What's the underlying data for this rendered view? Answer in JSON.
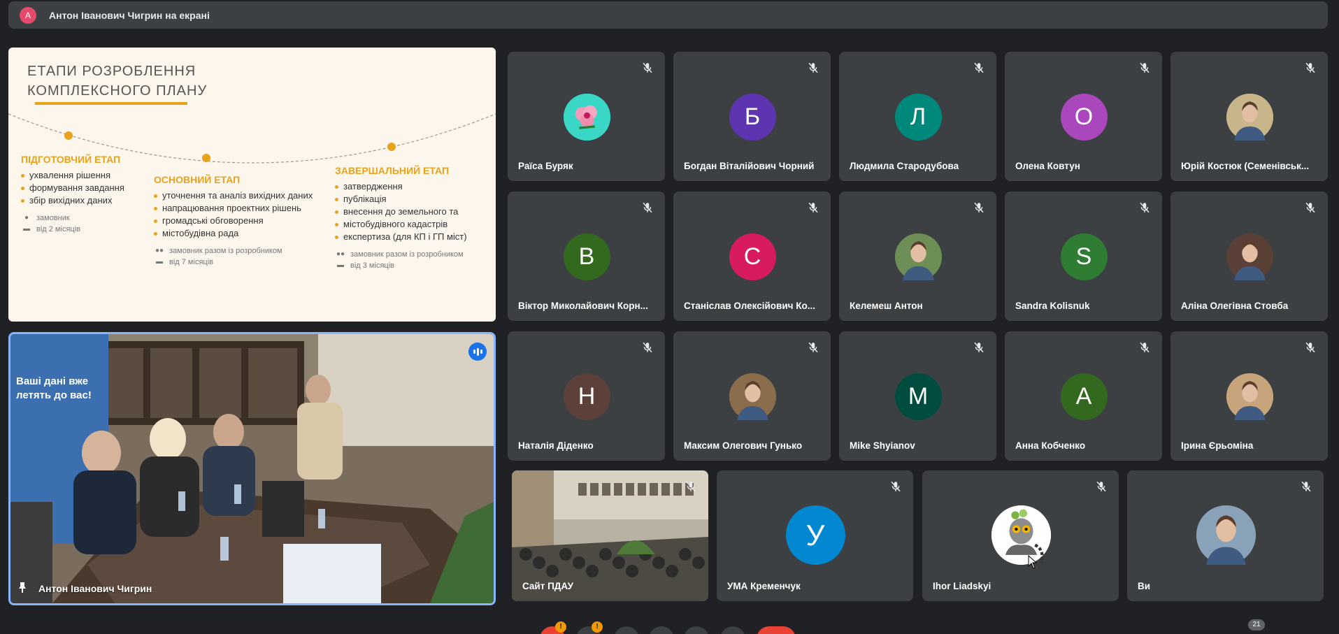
{
  "topbar": {
    "avatar_letter": "А",
    "presenting_text": "Антон Іванович Чигрин на екрані"
  },
  "slide": {
    "title_line1": "ЕТАПИ РОЗРОБЛЕННЯ",
    "title_line2": "КОМПЛЕКСНОГО ПЛАНУ",
    "stages": [
      {
        "title": "ПІДГОТОВЧИЙ ЕТАП",
        "items": [
          "ухвалення рішення",
          "формування завдання",
          "збір вихідних даних"
        ],
        "who": "замовник",
        "duration": "від 2 місяців"
      },
      {
        "title": "ОСНОВНИЙ ЕТАП",
        "items": [
          "уточнення та аналіз вихідних даних",
          "напрацювання проектних рішень",
          "громадські обговорення",
          "містобудівна рада"
        ],
        "who": "замовник разом із розробником",
        "duration": "від 7 місяців"
      },
      {
        "title": "ЗАВЕРШАЛЬНИЙ ЕТАП",
        "items": [
          "затвердження",
          "публікація",
          "внесення до земельного та",
          "містобудівного кадастрів",
          "експертиза (для КП і ГП міст)"
        ],
        "who": "замовник разом із розробником",
        "duration": "від 3 місяців"
      }
    ],
    "banner_text_line1": "Ваші дані вже",
    "banner_text_line2": "летять до вас!"
  },
  "speaker": {
    "name": "Антон Іванович Чигрин"
  },
  "participants": [
    {
      "name": "Раїса Буряк",
      "letter": "",
      "color": "#3ad6c6",
      "kind": "flower"
    },
    {
      "name": "Богдан Віталійович Чорний",
      "letter": "Б",
      "color": "#5e35b1"
    },
    {
      "name": "Людмила Стародубова",
      "letter": "Л",
      "color": "#00897b"
    },
    {
      "name": "Олена Ковтун",
      "letter": "О",
      "color": "#ab47bc"
    },
    {
      "name": "Юрій Костюк (Семенівськ...",
      "letter": "",
      "color": "#c9b58a",
      "kind": "photo"
    },
    {
      "name": "Віктор Миколайович Корн...",
      "letter": "В",
      "color": "#33691e"
    },
    {
      "name": "Станіслав Олексійович Ко...",
      "letter": "С",
      "color": "#d81b60"
    },
    {
      "name": "Келемеш Антон",
      "letter": "",
      "color": "#6d8f55",
      "kind": "photo"
    },
    {
      "name": "Sandra Kolisnuk",
      "letter": "S",
      "color": "#2e7d32"
    },
    {
      "name": "Аліна Олегівна Стовба",
      "letter": "",
      "color": "#5b4037",
      "kind": "photo"
    },
    {
      "name": "Наталія Діденко",
      "letter": "Н",
      "color": "#5d4037"
    },
    {
      "name": "Максим Олегович Гунько",
      "letter": "",
      "color": "#8a6e4b",
      "kind": "photo"
    },
    {
      "name": "Mike Shyianov",
      "letter": "M",
      "color": "#004d40"
    },
    {
      "name": "Анна Кобченко",
      "letter": "А",
      "color": "#33691e"
    },
    {
      "name": "Ірина Єрьоміна",
      "letter": "",
      "color": "#c8a47c",
      "kind": "photo"
    }
  ],
  "bottom_tiles": [
    {
      "name": "Сайт ПДАУ",
      "letter": "",
      "color": "#7d7a6e",
      "kind": "video"
    },
    {
      "name": "УМА Кременчук",
      "letter": "У",
      "color": "#0288d1"
    },
    {
      "name": "Ihor Liadskyi",
      "letter": "",
      "color": "#ffffff",
      "kind": "lemur"
    },
    {
      "name": "Ви",
      "letter": "",
      "color": "#8aa2b8",
      "kind": "photo"
    }
  ],
  "controls": {
    "badge1": "!",
    "badge2": "!",
    "participants_count": "21"
  }
}
